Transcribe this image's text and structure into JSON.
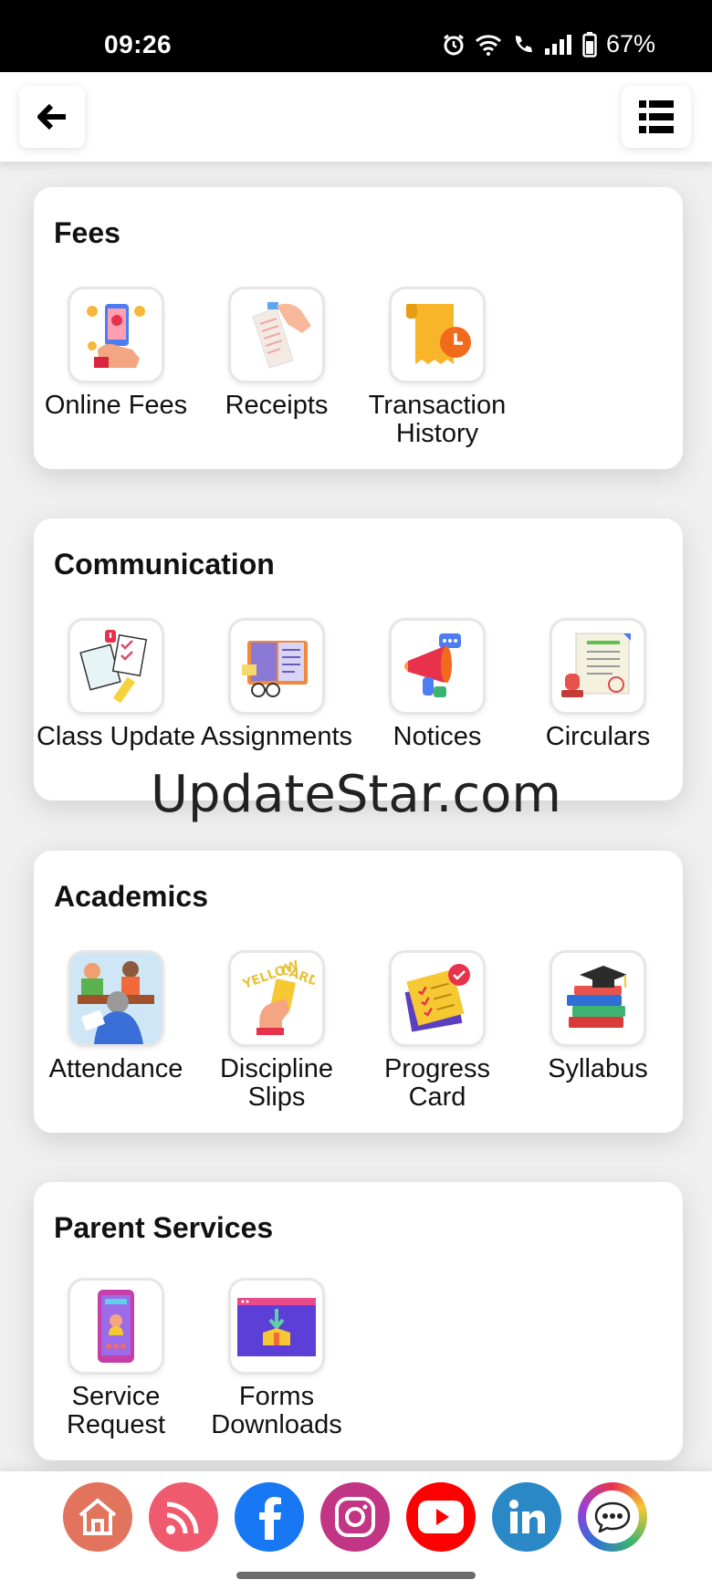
{
  "status_bar": {
    "time": "09:26",
    "battery": "67%"
  },
  "header": {
    "back_icon": "arrow-left-icon",
    "menu_icon": "list-icon"
  },
  "sections": [
    {
      "title": "Fees",
      "items": [
        {
          "label": "Online Fees",
          "icon": "phone-payment-icon"
        },
        {
          "label": "Receipts",
          "icon": "receipt-icon"
        },
        {
          "label": "Transaction History",
          "icon": "history-clock-icon"
        }
      ]
    },
    {
      "title": "Communication",
      "items": [
        {
          "label": "Class Update",
          "icon": "class-update-icon"
        },
        {
          "label": "Assignments",
          "icon": "notebook-icon"
        },
        {
          "label": "Notices",
          "icon": "megaphone-icon"
        },
        {
          "label": "Circulars",
          "icon": "certificate-icon"
        }
      ]
    },
    {
      "title": "Academics",
      "items": [
        {
          "label": "Attendance",
          "icon": "classroom-icon"
        },
        {
          "label": "Discipline Slips",
          "icon": "yellow-card-icon"
        },
        {
          "label": "Progress Card",
          "icon": "report-card-icon"
        },
        {
          "label": "Syllabus",
          "icon": "books-icon"
        }
      ]
    },
    {
      "title": "Parent Services",
      "items": [
        {
          "label": "Service Request",
          "icon": "support-phone-icon"
        },
        {
          "label": "Forms Downloads",
          "icon": "download-box-icon"
        }
      ]
    }
  ],
  "watermark": "UpdateStar.com",
  "bottom_bar": [
    {
      "name": "home",
      "color": "#e2735c"
    },
    {
      "name": "rss",
      "color": "#ef5a6f"
    },
    {
      "name": "facebook",
      "color": "#1877f2"
    },
    {
      "name": "instagram",
      "color": "#c13584"
    },
    {
      "name": "youtube",
      "color": "#ff0000"
    },
    {
      "name": "linkedin",
      "color": "#2b88c7"
    },
    {
      "name": "chat",
      "color": "#ffffff"
    }
  ]
}
